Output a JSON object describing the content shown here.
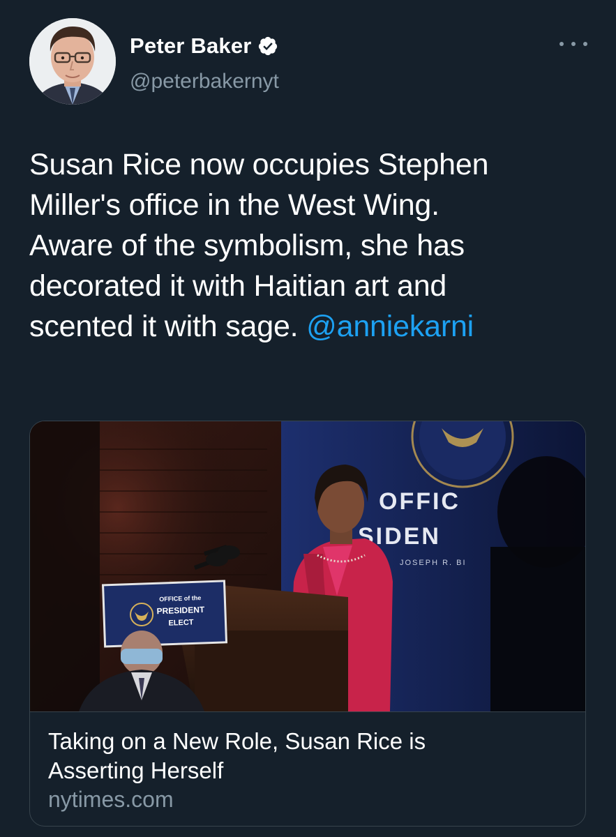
{
  "author": {
    "display_name": "Peter Baker",
    "handle": "@peterbakernyt",
    "verified": true
  },
  "tweet": {
    "text_lines": [
      "Susan Rice now occupies Stephen",
      "Miller's office in the West Wing.",
      "Aware of the symbolism, she has",
      "decorated it with Haitian art and",
      "scented it with sage. "
    ],
    "mention": "@anniekarni"
  },
  "card": {
    "title_lines": [
      "Taking on a New Role, Susan Rice is",
      "Asserting Herself"
    ],
    "domain": "nytimes.com",
    "image": {
      "podium_sign": [
        "OFFICE of the",
        "PRESIDENT",
        "ELECT"
      ],
      "backdrop_text": [
        "OFFIC",
        "SIDEN",
        "JOSEPH R. BI"
      ]
    }
  },
  "icons": {
    "verified": "verified-badge-icon",
    "more": "more-options-icon"
  },
  "colors": {
    "background": "#15202b",
    "link": "#1da1f2",
    "secondary_text": "#8899a6",
    "border": "#38444d"
  }
}
